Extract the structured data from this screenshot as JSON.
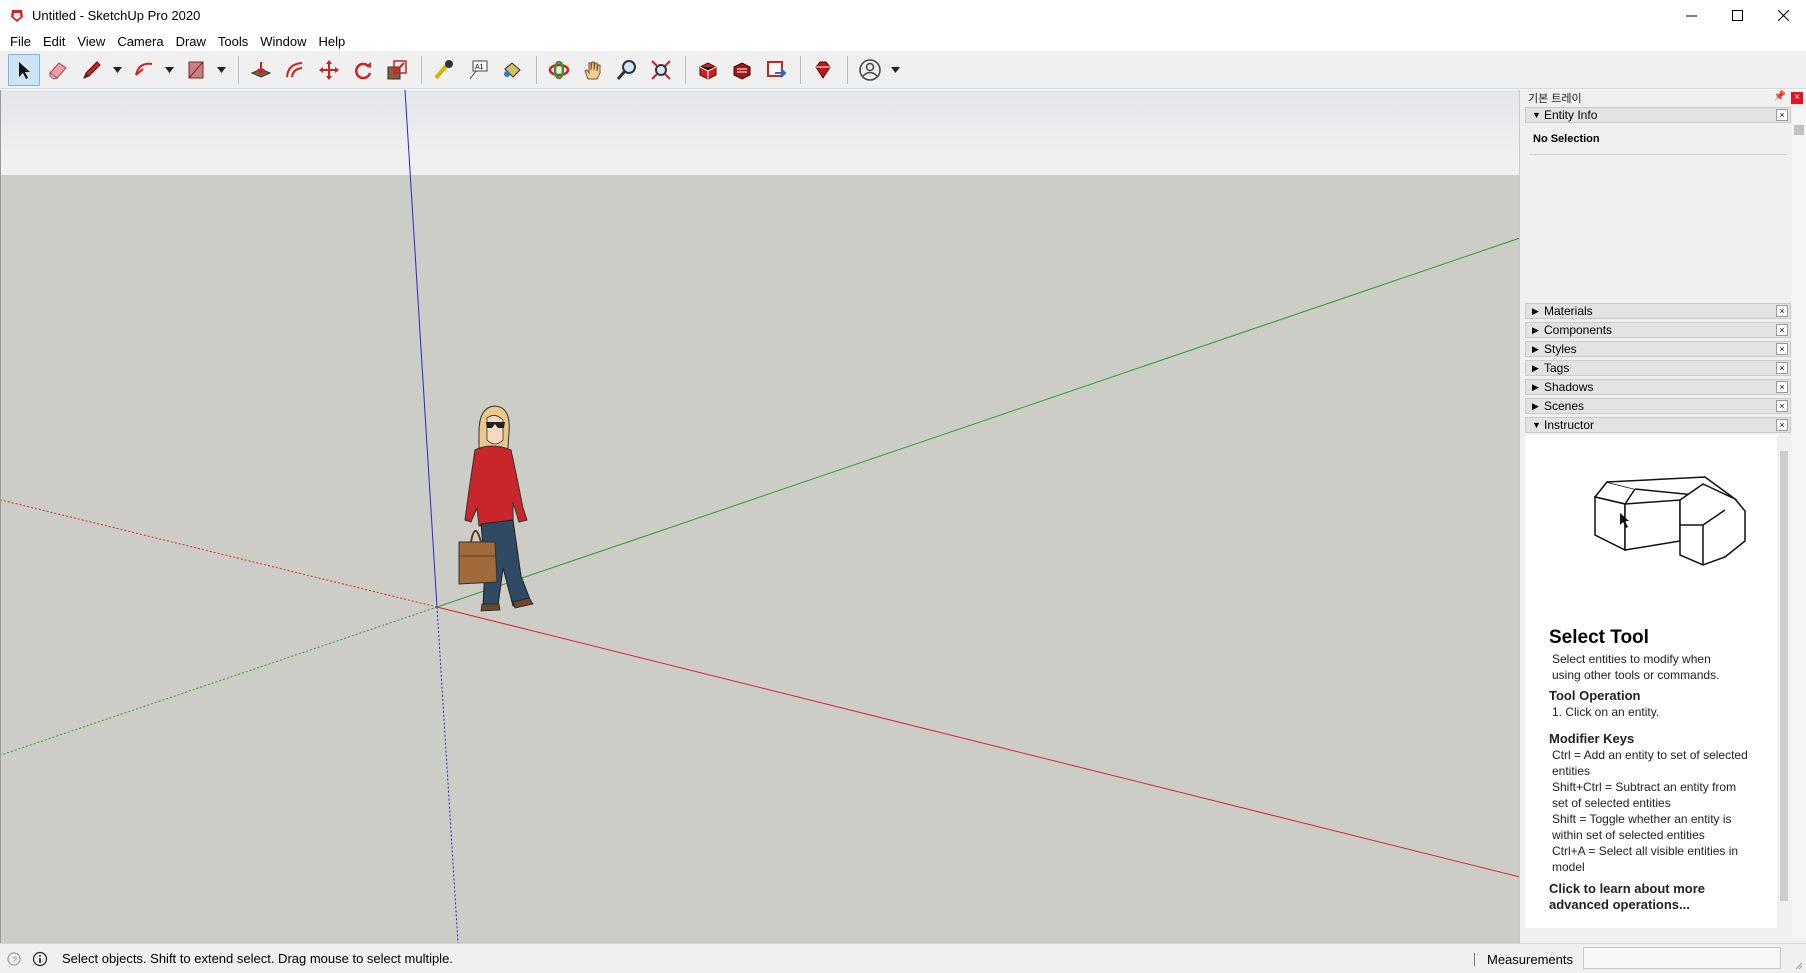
{
  "window": {
    "title": "Untitled - SketchUp Pro 2020",
    "controls": [
      "minimize-icon",
      "maximize-icon",
      "close-icon"
    ]
  },
  "menu": [
    {
      "label": "File"
    },
    {
      "label": "Edit"
    },
    {
      "label": "View"
    },
    {
      "label": "Camera"
    },
    {
      "label": "Draw"
    },
    {
      "label": "Tools"
    },
    {
      "label": "Window"
    },
    {
      "label": "Help"
    }
  ],
  "toolbar": {
    "tools": [
      "select-arrow-icon",
      "eraser-icon",
      "pencil-line-icon",
      "arc-icon",
      "rectangle-icon",
      "push-pull-icon",
      "offset-icon",
      "move-icon",
      "rotate-icon",
      "scale-icon",
      "tape-measure-icon",
      "text-icon",
      "paint-bucket-icon",
      "orbit-icon",
      "pan-icon",
      "zoom-icon",
      "zoom-extents-icon",
      "3d-warehouse-icon",
      "extension-warehouse-icon",
      "layout-icon",
      "extension-manager-icon",
      "account-icon"
    ]
  },
  "tray": {
    "title": "기본 트레이",
    "entity_info": {
      "label": "Entity Info",
      "selection": "No Selection"
    },
    "panels": [
      {
        "label": "Materials"
      },
      {
        "label": "Components"
      },
      {
        "label": "Styles"
      },
      {
        "label": "Tags"
      },
      {
        "label": "Shadows"
      },
      {
        "label": "Scenes"
      },
      {
        "label": "Instructor"
      }
    ],
    "instructor": {
      "title": "Select Tool",
      "description": "Select entities to modify when using other tools or commands.",
      "operation_heading": "Tool Operation",
      "operation_text": "1. Click on an entity.",
      "modifier_heading": "Modifier Keys",
      "modifier_lines": [
        "Ctrl = Add an entity to set of selected entities",
        "Shift+Ctrl = Subtract an entity from set of selected entities",
        "Shift = Toggle whether an entity is within set of selected entities",
        "Ctrl+A = Select all visible entities in model"
      ],
      "link": "Click to learn about more advanced operations..."
    }
  },
  "status": {
    "message": "Select objects. Shift to extend select. Drag mouse to select multiple.",
    "measurements_label": "Measurements",
    "measurements_value": ""
  },
  "colors": {
    "axis_red": "#d42a2a",
    "axis_green": "#2e9e2e",
    "axis_blue": "#2828c8",
    "ground": "#cdcdc8",
    "sky": "#e9ebed"
  }
}
